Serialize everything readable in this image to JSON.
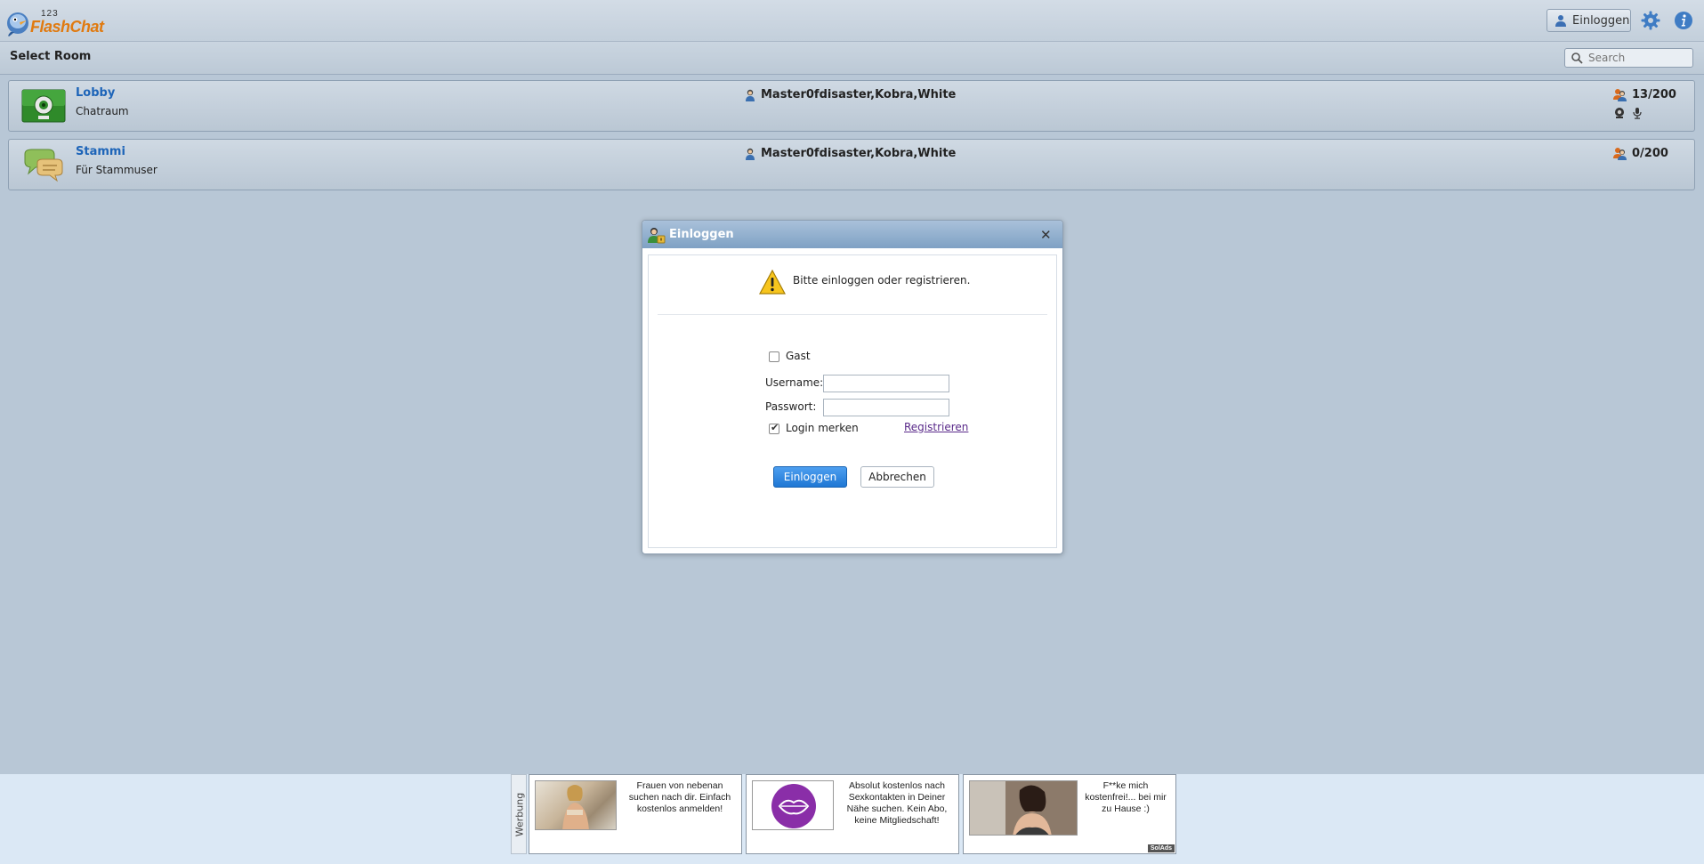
{
  "app": {
    "logo_num": "123",
    "logo_text": "FlashChat"
  },
  "topbar": {
    "login_label": "Einloggen"
  },
  "roombar": {
    "title": "Select Room",
    "search_placeholder": "Search"
  },
  "rooms": [
    {
      "name": "Lobby",
      "description": "Chatraum",
      "users": "Master0fdisaster,Kobra,White",
      "count": "13/200"
    },
    {
      "name": "Stammi",
      "description": "Für Stammuser",
      "users": "Master0fdisaster,Kobra,White",
      "count": "0/200"
    }
  ],
  "dialog": {
    "title": "Einloggen",
    "message": "Bitte einloggen oder registrieren.",
    "guest_label": "Gast",
    "guest_checked": false,
    "username_label": "Username:",
    "username_value": "",
    "password_label": "Passwort:",
    "password_value": "",
    "remember_label": "Login merken",
    "remember_checked": true,
    "register_link": "Registrieren",
    "login_button": "Einloggen",
    "cancel_button": "Abbrechen"
  },
  "ads": {
    "label": "Werbung",
    "items": [
      {
        "text": "Frauen von nebenan suchen nach dir. Einfach kostenlos anmelden!"
      },
      {
        "text": "Absolut kostenlos nach Sexkontakten in Deiner Nähe suchen. Kein Abo, keine Mitgliedschaft!"
      },
      {
        "text": "F**ke mich kostenfrei!... bei mir zu Hause :)"
      }
    ],
    "badge": "SolAds"
  },
  "colors": {
    "background": "#b8c7d6",
    "link_blue": "#1d64b8",
    "primary_button": "#2b84e0",
    "logo_orange": "#e07a10"
  }
}
